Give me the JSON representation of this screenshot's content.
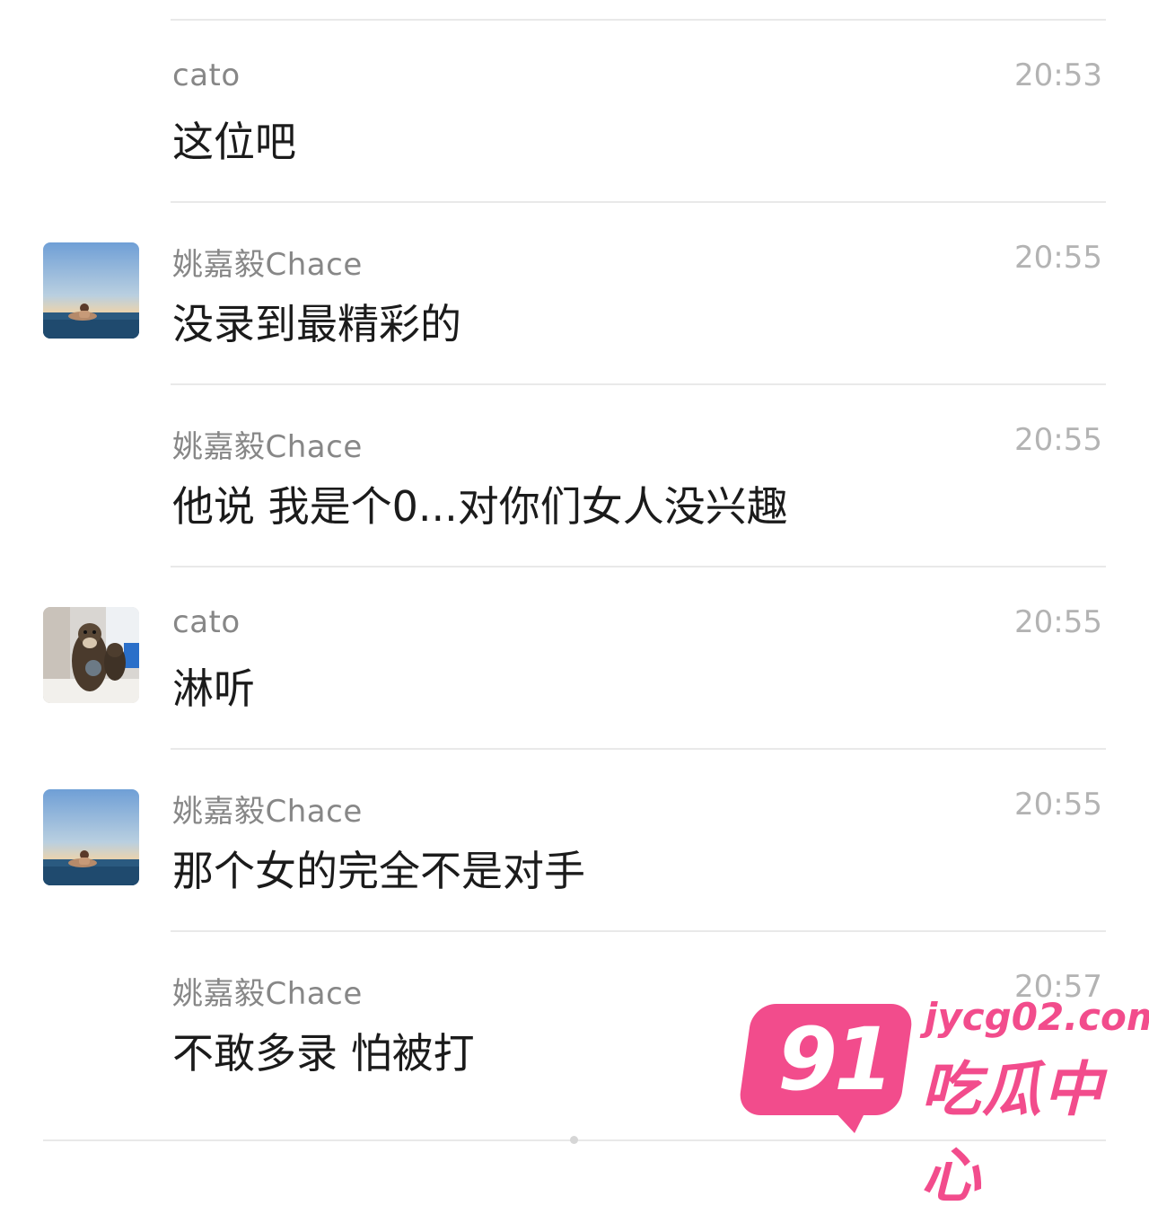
{
  "messages": [
    {
      "sender": "cato",
      "time": "20:53",
      "text": "这位吧",
      "avatar": "none"
    },
    {
      "sender": "姚嘉毅Chace",
      "time": "20:55",
      "text": "没录到最精彩的",
      "avatar": "sea-pool-photo"
    },
    {
      "sender": "姚嘉毅Chace",
      "time": "20:55",
      "text": "他说 我是个0...对你们女人没兴趣",
      "avatar": "none"
    },
    {
      "sender": "cato",
      "time": "20:55",
      "text": "淋听",
      "avatar": "otter-photo"
    },
    {
      "sender": "姚嘉毅Chace",
      "time": "20:55",
      "text": "那个女的完全不是对手",
      "avatar": "sea-pool-photo"
    },
    {
      "sender": "姚嘉毅Chace",
      "time": "20:57",
      "text": "不敢多录 怕被打",
      "avatar": "none"
    }
  ],
  "watermark": {
    "number": "91",
    "url": "jycg02.com",
    "name": "吃瓜中心",
    "color": "#f24c8c"
  }
}
